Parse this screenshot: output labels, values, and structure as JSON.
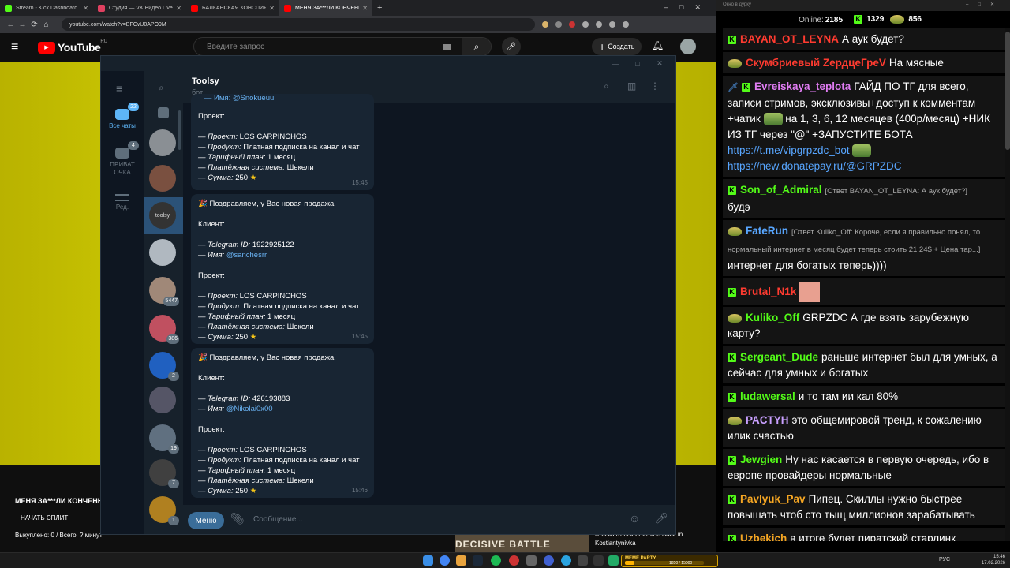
{
  "browser": {
    "tabs": [
      {
        "title": "Stream - Kick Dashboard",
        "color": "#53fc18",
        "active": false
      },
      {
        "title": "Студия — VK Видео Live",
        "color": "#e04060",
        "active": false
      },
      {
        "title": "БАЛКАНСКАЯ КОНСПИРОЛОГ",
        "color": "#ff0000",
        "active": false
      },
      {
        "title": "МЕНЯ ЗА***ЛИ КОНЧЕННЫЕ",
        "color": "#ff0000",
        "active": true
      }
    ],
    "new_tab": "+",
    "url": "youtube.com/watch?v=BFCvU0APO9M"
  },
  "youtube": {
    "logo": "YouTube",
    "region": "RU",
    "search_placeholder": "Введите запрос",
    "create_label": "Создать",
    "video_title": "МЕНЯ ЗА***ЛИ КОНЧЕННЫЕ",
    "split_label": "НАЧАТЬ СПЛИТ",
    "bought_text": "Выкуплено: 0 / Всего: ? минут",
    "related_thumb": "DECISIVE BATTLE",
    "related_title": "Russia Knocks Ukraine Back in Kostiantynivka"
  },
  "telegram": {
    "folders": [
      {
        "label": "Все чаты",
        "badge": "22",
        "active": true
      },
      {
        "label": "ПРИВАТ ОЧКА",
        "badge": "4",
        "active": false
      },
      {
        "label": "Ред.",
        "badge": "",
        "active": false
      }
    ],
    "chat_badges": [
      "",
      "",
      "",
      "",
      "5447",
      "386",
      "2",
      "",
      "19",
      "7",
      "1"
    ],
    "chat": {
      "name": "Toolsy",
      "status": "бот"
    },
    "messages": [
      {
        "partial_top": "— Имя: @Snokueuu",
        "project_label": "Проект:",
        "project": "LOS CARPINCHOS",
        "product": "Платная подписка на канал и чат",
        "plan": "1 месяц",
        "payment": "Шекели",
        "amount": "250",
        "time": "15:45"
      },
      {
        "header": "Поздравляем, у Вас новая продажа!",
        "client_label": "Клиент:",
        "telegram_id": "1922925122",
        "username": "@sanchesrr",
        "project_label": "Проект:",
        "project": "LOS CARPINCHOS",
        "product": "Платная подписка на канал и чат",
        "plan": "1 месяц",
        "payment": "Шекели",
        "amount": "250",
        "time": "15:45"
      },
      {
        "header": "Поздравляем, у Вас новая продажа!",
        "client_label": "Клиент:",
        "telegram_id": "426193883",
        "username": "@Nikolai0x00",
        "project_label": "Проект:",
        "project": "LOS CARPINCHOS",
        "product": "Платная подписка на канал и чат",
        "plan": "1 месяц",
        "payment": "Шекели",
        "amount": "250",
        "time": "15:46"
      }
    ],
    "field_labels": {
      "telegram_id": "— Telegram ID:",
      "name": "— Имя:",
      "project": "— Проект:",
      "product": "— Продукт:",
      "plan": "— Тарифный план:",
      "payment": "— Платёжная система:",
      "amount": "— Сумма:"
    },
    "menu_button": "Меню",
    "input_placeholder": "Сообщение..."
  },
  "stream_chat": {
    "window_title": "Окно в дурку",
    "online_label": "Online:",
    "online": "2185",
    "stat2": "1329",
    "stat3": "856",
    "messages": [
      {
        "badge": "kick",
        "user": "BAYAN_OT_LEYNA",
        "color": "#ff3b30",
        "text": "А аук будет?"
      },
      {
        "badge": "emote",
        "user": "Скумбриевый ZердцеГреV",
        "color": "#ff3b30",
        "text": "На мясные"
      },
      {
        "badge": "kick-sword",
        "user": "Evreiskaya_teplota",
        "color": "#e07cf2",
        "text": "ГАЙД ПО ТГ для всего, записи стримов, эксклюзивы+доступ к комментам +чатик",
        "text2": "на 1, 3, 6, 12 месяцев (400р/месяц) +НИК ИЗ ТГ через \"@\" +ЗАПУСТИТЕ БОТА",
        "link1": "https://t.me/vipgrpzdc_bot",
        "link2": "https://new.donatepay.ru/@GRPZDC"
      },
      {
        "badge": "kick",
        "user": "Son_of_Admiral",
        "color": "#53fc18",
        "reply": "[Ответ BAYAN_OT_LEYNA: А аук будет?]",
        "text": "будэ"
      },
      {
        "badge": "emote",
        "user": "FateRun",
        "color": "#58a6ff",
        "reply": "[Ответ Kuliko_Off: Короче, если я правильно понял, то нормальный интернет в месяц будет теперь стоить 21,24$ + Цена тар...]",
        "text": "интернет для богатых теперь))))"
      },
      {
        "badge": "kick",
        "user": "Brutal_N1k",
        "color": "#ff3b30",
        "text": ""
      },
      {
        "badge": "emote",
        "user": "Kuliko_Off",
        "color": "#53fc18",
        "text": "GRPZDC А где взять зарубежную карту?"
      },
      {
        "badge": "kick",
        "user": "Sergeant_Dude",
        "color": "#53fc18",
        "text": "раньше интернет был для умных, а сейчас для умных и богатых"
      },
      {
        "badge": "kick",
        "user": "ludawersal",
        "color": "#53fc18",
        "text": "и то там ии кал 80%"
      },
      {
        "badge": "emote",
        "user": "PACTYH",
        "color": "#c9a0ff",
        "text": "это общемировой тренд, к сожалению илик счастью"
      },
      {
        "badge": "kick",
        "user": "Jewgien",
        "color": "#53fc18",
        "text": "Ну нас касается в первую очередь, ибо в европе провайдеры нормальные"
      },
      {
        "badge": "kick",
        "user": "Pavlyuk_Pav",
        "color": "#f5a623",
        "text": "Пипец. Скиллы нужно быстрее повышать чтоб сто тыщ миллионов зарабатывать"
      },
      {
        "badge": "kick",
        "user": "Uzbekich",
        "color": "#f5a623",
        "text": "в итоге будет пиратский старлинк"
      }
    ]
  },
  "taskbar": {
    "widget_name": "МЕМЕ PARTY",
    "widget_value": "1850 / 15000",
    "widget_fraction": 0.12,
    "lang": "РУС",
    "time": "15:46",
    "date": "17.02.2026"
  }
}
